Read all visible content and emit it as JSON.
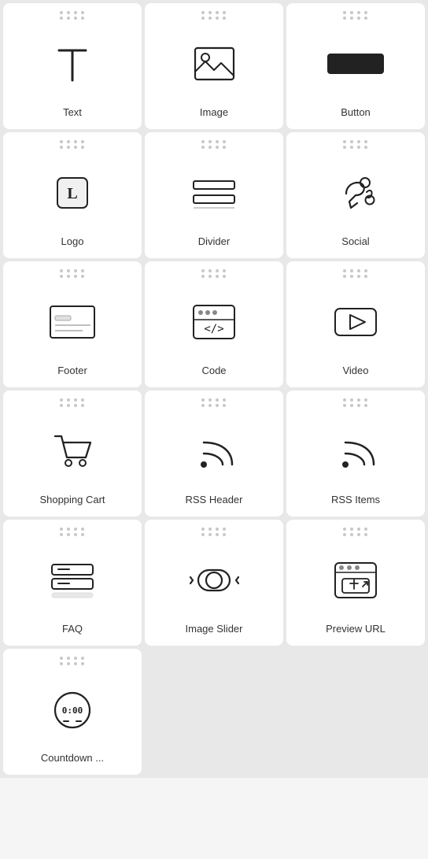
{
  "items": [
    {
      "id": "text",
      "label": "Text",
      "icon": "text"
    },
    {
      "id": "image",
      "label": "Image",
      "icon": "image"
    },
    {
      "id": "button",
      "label": "Button",
      "icon": "button"
    },
    {
      "id": "logo",
      "label": "Logo",
      "icon": "logo"
    },
    {
      "id": "divider",
      "label": "Divider",
      "icon": "divider"
    },
    {
      "id": "social",
      "label": "Social",
      "icon": "social"
    },
    {
      "id": "footer",
      "label": "Footer",
      "icon": "footer"
    },
    {
      "id": "code",
      "label": "Code",
      "icon": "code"
    },
    {
      "id": "video",
      "label": "Video",
      "icon": "video"
    },
    {
      "id": "shopping-cart",
      "label": "Shopping Cart",
      "icon": "cart"
    },
    {
      "id": "rss-header",
      "label": "RSS Header",
      "icon": "rss"
    },
    {
      "id": "rss-items",
      "label": "RSS Items",
      "icon": "rss2"
    },
    {
      "id": "faq",
      "label": "FAQ",
      "icon": "faq"
    },
    {
      "id": "image-slider",
      "label": "Image Slider",
      "icon": "slider"
    },
    {
      "id": "preview-url",
      "label": "Preview URL",
      "icon": "preview-url"
    },
    {
      "id": "countdown",
      "label": "Countdown ...",
      "icon": "countdown"
    }
  ]
}
